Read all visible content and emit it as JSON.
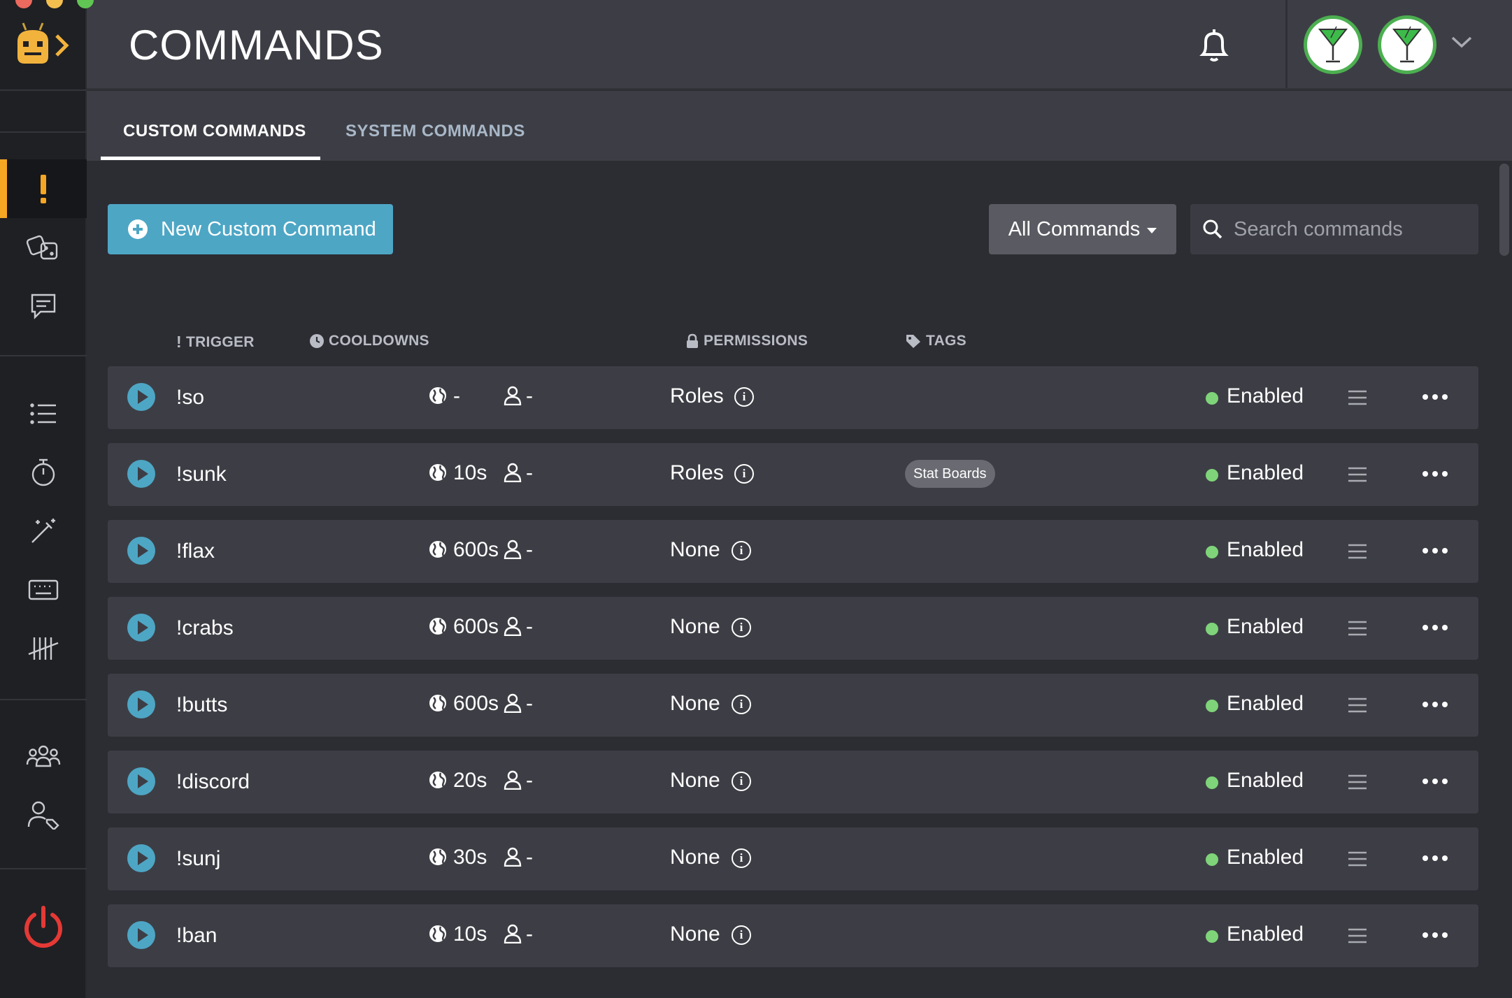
{
  "header": {
    "title": "COMMANDS"
  },
  "tabs": [
    {
      "label": "CUSTOM COMMANDS",
      "active": true
    },
    {
      "label": "SYSTEM COMMANDS",
      "active": false
    }
  ],
  "toolbar": {
    "new_label": "New Custom Command",
    "filter_label": "All Commands",
    "search_placeholder": "Search commands"
  },
  "columns": {
    "trigger": "TRIGGER",
    "cooldowns": "COOLDOWNS",
    "permissions": "PERMISSIONS",
    "tags": "TAGS"
  },
  "commands": [
    {
      "trigger": "!so",
      "global_cooldown": "-",
      "user_cooldown": "-",
      "permission": "Roles",
      "tag": "",
      "status": "Enabled"
    },
    {
      "trigger": "!sunk",
      "global_cooldown": "10s",
      "user_cooldown": "-",
      "permission": "Roles",
      "tag": "Stat Boards",
      "status": "Enabled"
    },
    {
      "trigger": "!flax",
      "global_cooldown": "600s",
      "user_cooldown": "-",
      "permission": "None",
      "tag": "",
      "status": "Enabled"
    },
    {
      "trigger": "!crabs",
      "global_cooldown": "600s",
      "user_cooldown": "-",
      "permission": "None",
      "tag": "",
      "status": "Enabled"
    },
    {
      "trigger": "!butts",
      "global_cooldown": "600s",
      "user_cooldown": "-",
      "permission": "None",
      "tag": "",
      "status": "Enabled"
    },
    {
      "trigger": "!discord",
      "global_cooldown": "20s",
      "user_cooldown": "-",
      "permission": "None",
      "tag": "",
      "status": "Enabled"
    },
    {
      "trigger": "!sunj",
      "global_cooldown": "30s",
      "user_cooldown": "-",
      "permission": "None",
      "tag": "",
      "status": "Enabled"
    },
    {
      "trigger": "!ban",
      "global_cooldown": "10s",
      "user_cooldown": "-",
      "permission": "None",
      "tag": "",
      "status": "Enabled"
    }
  ],
  "colors": {
    "accent": "#4ea6c5",
    "active_marker": "#f5a623",
    "enabled_dot": "#7fd47a",
    "power": "#e53935",
    "avatar_ring": "#4caf50"
  },
  "icons": {
    "sidebar": [
      "exclamation-icon",
      "dice-icon",
      "chat-icon",
      "list-icon",
      "timer-icon",
      "magic-wand-icon",
      "keyboard-icon",
      "tally-icon",
      "users-icon",
      "user-tag-icon"
    ],
    "power": "power-icon",
    "bell": "bell-icon"
  }
}
